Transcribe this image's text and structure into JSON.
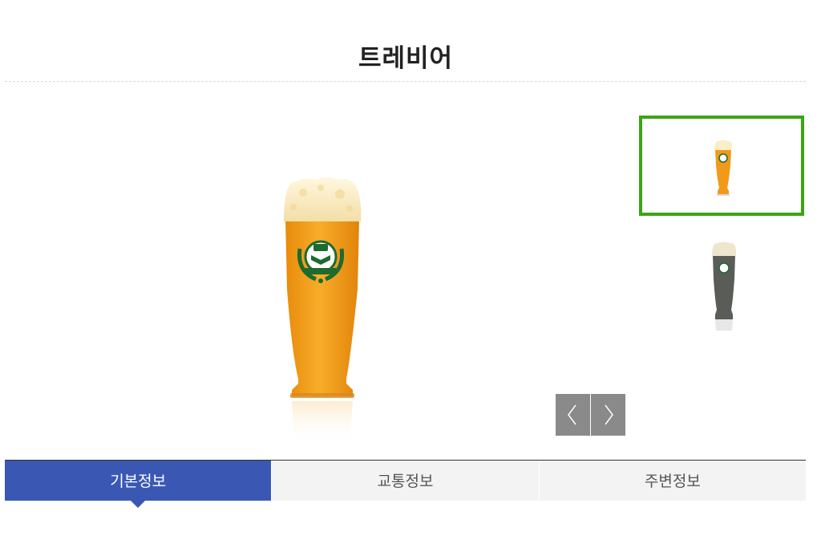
{
  "page": {
    "title": "트레비어"
  },
  "gallery": {
    "main_image": "wheat-beer-glass-image",
    "thumbnails": [
      {
        "image": "wheat-beer-glass-thumbnail",
        "selected": true
      },
      {
        "image": "dark-beer-glass-thumbnail",
        "selected": false
      }
    ],
    "prev_icon": "chevron-left-icon",
    "next_icon": "chevron-right-icon"
  },
  "tabs": [
    {
      "label": "기본정보",
      "active": true
    },
    {
      "label": "교통정보",
      "active": false
    },
    {
      "label": "주변정보",
      "active": false
    }
  ],
  "colors": {
    "accent_tab": "#3a58b3",
    "thumbnail_selected_border": "#3aa514",
    "arrow_bg": "#8a8a8a"
  }
}
